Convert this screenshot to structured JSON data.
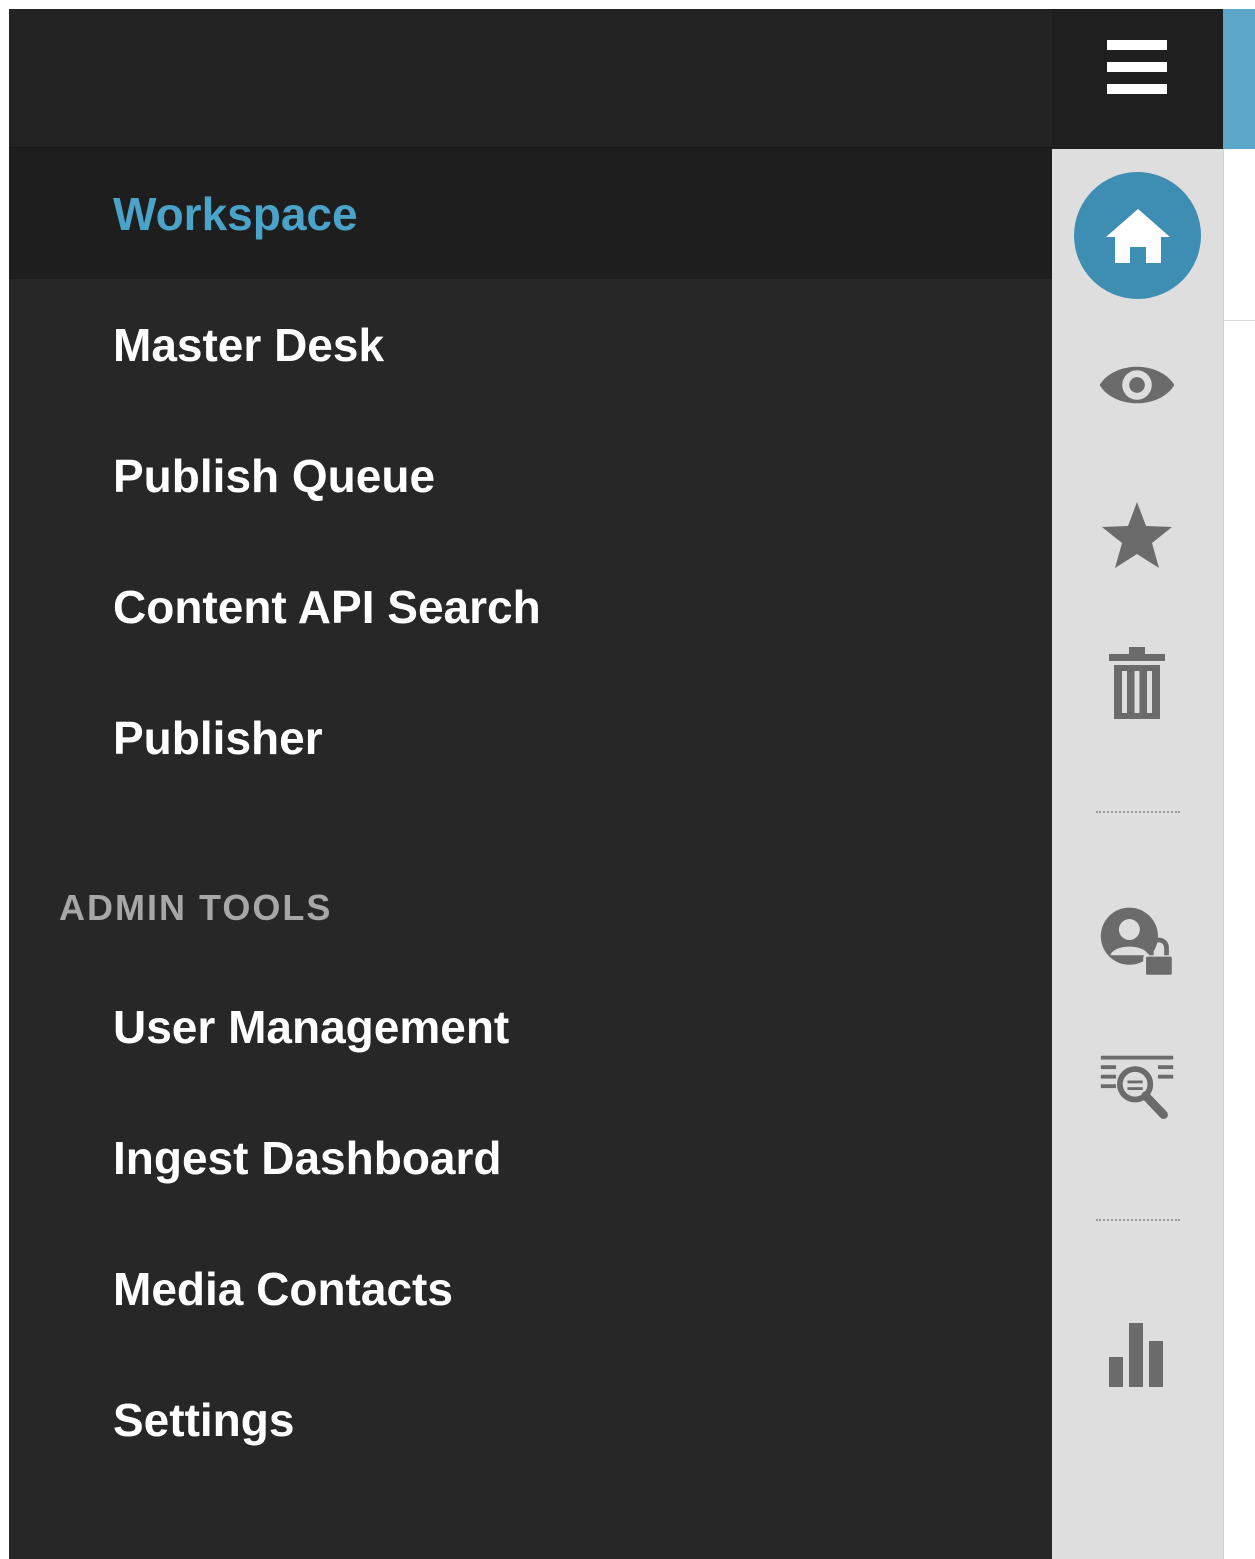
{
  "nav": {
    "items": [
      {
        "label": "Workspace",
        "active": true
      },
      {
        "label": "Master Desk"
      },
      {
        "label": "Publish Queue"
      },
      {
        "label": "Content API Search"
      },
      {
        "label": "Publisher"
      }
    ],
    "admin_section_label": "ADMIN TOOLS",
    "admin_items": [
      {
        "label": "User Management"
      },
      {
        "label": "Ingest Dashboard"
      },
      {
        "label": "Media Contacts"
      },
      {
        "label": "Settings"
      }
    ]
  },
  "rail": {
    "icons": [
      "menu-icon",
      "home-icon",
      "eye-icon",
      "star-icon",
      "trash-icon",
      "user-lock-icon",
      "search-list-icon",
      "bar-chart-icon"
    ]
  },
  "colors": {
    "accent": "#4aa3c8",
    "drawer_bg": "#272727",
    "rail_bg": "#dedede",
    "home_button": "#3e8db3",
    "rail_icon": "#6b6b6b"
  }
}
